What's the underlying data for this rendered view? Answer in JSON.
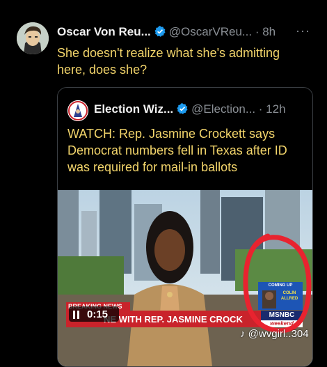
{
  "tweet": {
    "author_name": "Oscar Von Reu...",
    "handle": "@OscarVReu...",
    "time": "· 8h",
    "more": "···",
    "text": "She doesn't realize what she's admitting here, does she?"
  },
  "quoted_tweet": {
    "author_name": "Election Wiz...",
    "handle": "@Election...",
    "time": "· 12h",
    "text": "WATCH: Rep. Jasmine Crockett says Democrat numbers fell in Texas after ID was required for mail-in ballots",
    "video": {
      "elapsed": "0:15",
      "breaking_label": "BREAKING NEWS",
      "lower_third": "NE WITH REP. JASMINE CROCK",
      "network": "MSNBC",
      "block": "weekend",
      "coming_up_label": "COMING UP",
      "coming_up_name": "COLIN ALLRED",
      "watermark": "@wvgirl..304"
    }
  },
  "colors": {
    "accent_text": "#f3d56b",
    "verified": "#1d9bf0",
    "circle_annotation": "#e8232f",
    "lower_third": "#c9232b"
  }
}
